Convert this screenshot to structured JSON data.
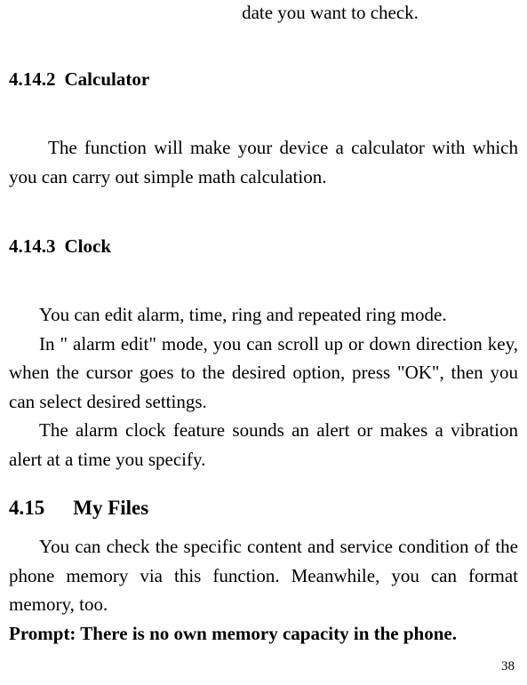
{
  "intro_fragment": "date you want to check.",
  "section_4_14_2": {
    "number": "4.14.2",
    "title": "Calculator",
    "paragraph": "The function will make your device a calculator with which you can carry out simple math calculation."
  },
  "section_4_14_3": {
    "number": "4.14.3",
    "title": "Clock",
    "para1": "You can edit alarm, time, ring and repeated ring mode.",
    "para2": "In \" alarm edit\" mode,   you can scroll up or down direction key, when the cursor goes to the desired option, press \"OK\", then you can select desired settings.",
    "para3": "The alarm clock feature sounds an alert or makes a vibration alert at a time you specify."
  },
  "section_4_15": {
    "number": "4.15",
    "title": "My Files",
    "para": "You can check the specific content and service condition of the phone memory via this function. Meanwhile, you can format memory, too.",
    "prompt": "Prompt: There is no own memory capacity in the phone."
  },
  "page_number": "38"
}
